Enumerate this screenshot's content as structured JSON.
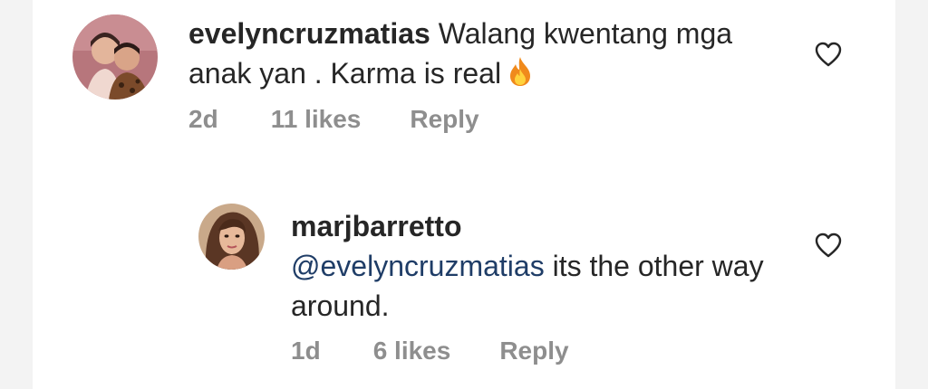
{
  "comments": [
    {
      "username": "evelyncruzmatias",
      "text": " Walang kwentang mga anak yan . Karma is real",
      "time": "2d",
      "likes": "11 likes",
      "reply_label": "Reply",
      "emoji": "fire-emoji"
    },
    {
      "username": "marjbarretto",
      "mention": "@evelyncruzmatias",
      "text": " its the other way around.",
      "time": "1d",
      "likes": "6 likes",
      "reply_label": "Reply"
    }
  ],
  "icons": {
    "like": "heart-outline-icon"
  },
  "colors": {
    "text": "#262626",
    "meta": "#8e8e8e",
    "mention": "#1f3d67"
  }
}
